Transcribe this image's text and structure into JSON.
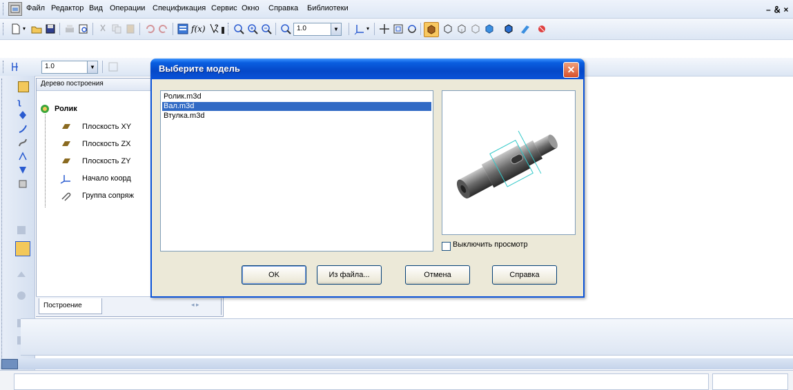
{
  "menu": {
    "items": [
      {
        "label": "Файл"
      },
      {
        "label": "Редактор"
      },
      {
        "label": "Вид"
      },
      {
        "label": "Операции"
      },
      {
        "label": "Спецификация"
      },
      {
        "label": "Сервис"
      },
      {
        "label": "Окно"
      },
      {
        "label": "Справка"
      },
      {
        "label": "Библиотеки"
      }
    ],
    "window_controls": "– ＆ ×"
  },
  "toolbar1": {
    "fx_label": "f(x)",
    "zoom_value": "1.0"
  },
  "toolbar2": {
    "step_value": "1.0"
  },
  "tree": {
    "header": "Дерево построения",
    "root": "Ролик",
    "items": [
      {
        "label": "Плоскость XY"
      },
      {
        "label": "Плоскость ZX"
      },
      {
        "label": "Плоскость ZY"
      },
      {
        "label": "Начало коорд"
      },
      {
        "label": "Группа сопряж"
      }
    ],
    "tab": "Построение",
    "tab_arrows": "◂ ▸"
  },
  "dialog": {
    "title": "Выберите модель",
    "close": "✕",
    "files": [
      "Ролик.m3d",
      "Вал.m3d",
      "Втулка.m3d"
    ],
    "selected_index": 1,
    "disable_preview_label": "Выключить просмотр",
    "disable_preview_checked": false,
    "buttons": {
      "ok": "OK",
      "from_file": "Из файла...",
      "cancel": "Отмена",
      "help": "Справка"
    }
  },
  "colors": {
    "title_bar": "#0a52d8",
    "selection": "#316ac5",
    "dialog_bg": "#ece9d8"
  }
}
